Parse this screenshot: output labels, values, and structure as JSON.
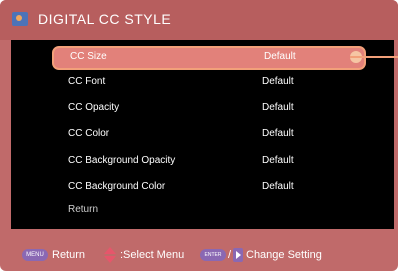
{
  "header": {
    "title": "DIGITAL CC STYLE",
    "icon": "settings-window-icon"
  },
  "menu": {
    "items": [
      {
        "label": "CC Size",
        "value": "Default",
        "selected": true
      },
      {
        "label": "CC Font",
        "value": "Default"
      },
      {
        "label": "CC Opacity",
        "value": "Default"
      },
      {
        "label": "CC Color",
        "value": "Default"
      },
      {
        "label": "CC Background Opacity",
        "value": "Default"
      },
      {
        "label": "CC Background Color",
        "value": "Default"
      },
      {
        "label": "Return",
        "value": ""
      }
    ]
  },
  "footer": {
    "menu_key": "MENU",
    "return_label": "Return",
    "select_label": ":Select Menu",
    "enter_key": "ENTER",
    "slash": "/",
    "change_label": "Change Setting"
  },
  "colors": {
    "frame": "#c06a6a",
    "panel": "#000000",
    "selection": "#e2817a",
    "selection_border": "#f2a07a",
    "key_button": "#8a68b3",
    "arrow": "#e6566b"
  }
}
